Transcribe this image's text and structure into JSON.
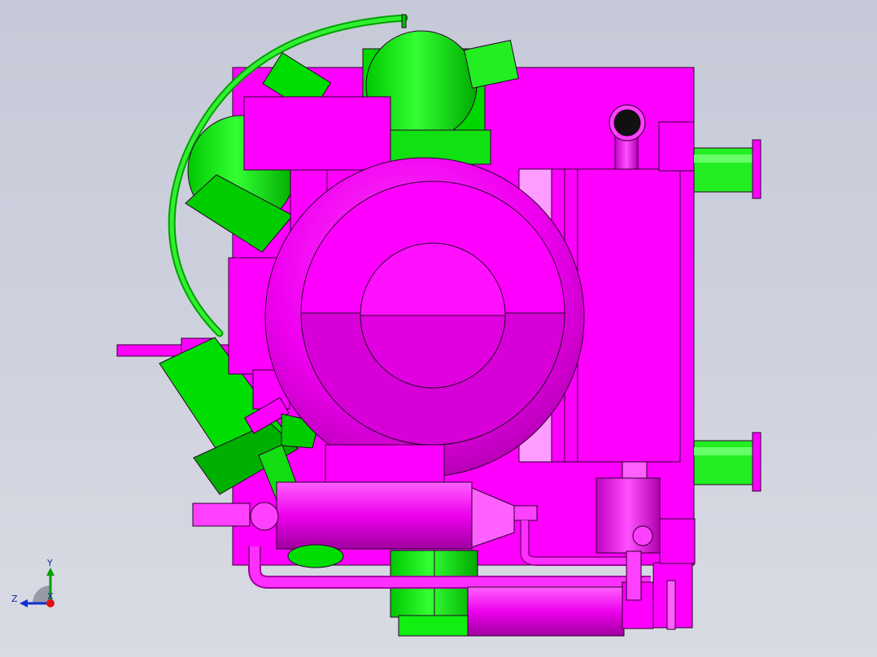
{
  "viewport": {
    "view_name": "Front",
    "background_top": "#c6cad8",
    "background_bottom": "#d9dbe3"
  },
  "model": {
    "body_color": "#ff00ff",
    "body_shade": "#c800c8",
    "body_highlight": "#ff9cff",
    "component_color": "#00ff00",
    "component_shade": "#00b400",
    "edge_color": "#2a002a"
  },
  "triad": {
    "y_label": "Y",
    "z_label": "Z",
    "x_label": "X",
    "y_color": "#00a000",
    "z_color": "#1030d0",
    "x_color": "#e01010"
  }
}
